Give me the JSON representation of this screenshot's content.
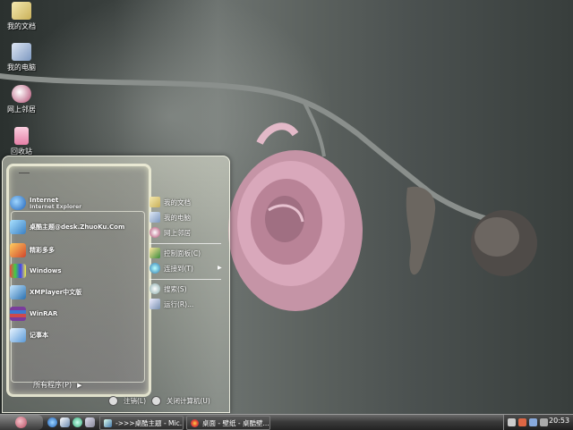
{
  "desktop": {
    "icons": [
      {
        "label": "我的文档"
      },
      {
        "label": "我的电脑"
      },
      {
        "label": "网上邻居"
      },
      {
        "label": "回收站"
      }
    ]
  },
  "start_menu": {
    "pinned": [
      {
        "title": "Internet",
        "subtitle": "Internet Explorer"
      },
      {
        "title": "桌酷主题@desk.ZhuoKu.Com"
      }
    ],
    "recent": [
      {
        "title": "精彩多多"
      },
      {
        "title": "Windows"
      },
      {
        "title": "XMPlayer中文版"
      },
      {
        "title": "WinRAR"
      },
      {
        "title": "记事本"
      }
    ],
    "all_programs": "所有程序(P)",
    "all_programs_arrow": "▶",
    "right": [
      {
        "label": "我的文档"
      },
      {
        "label": "我的电脑"
      },
      {
        "label": "网上邻居"
      },
      {
        "label": "控制面板(C)"
      },
      {
        "label": "连接到(T)"
      },
      {
        "label": "搜索(S)"
      },
      {
        "label": "运行(R)..."
      }
    ],
    "submenu_arrow": "▶",
    "logoff": "注销(L)",
    "shutdown": "关闭计算机(U)"
  },
  "taskbar": {
    "tasks": [
      {
        "label": "->>>桌酷主题 - Mic..."
      },
      {
        "label": "桌面 - 壁纸 - 桌酷壁..."
      }
    ],
    "clock": "20:53"
  },
  "colors": {
    "taskbar_top": "#6a6a6a",
    "taskbar_bottom": "#222222",
    "menu_border": "#f5f5dc",
    "rose": "#d9a8bb"
  }
}
